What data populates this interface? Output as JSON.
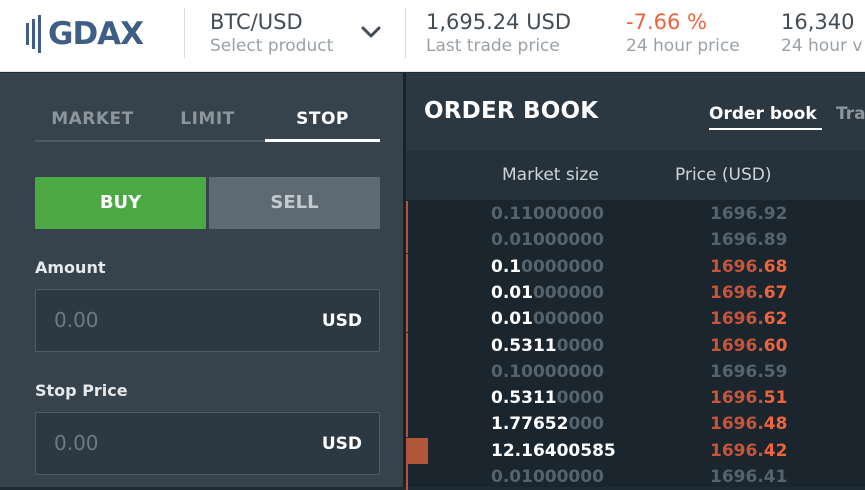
{
  "header": {
    "logo": "GDAX",
    "product": "BTC/USD",
    "product_sub": "Select product",
    "last_price": "1,695.24 USD",
    "last_price_sub": "Last trade price",
    "change": "-7.66 %",
    "change_sub": "24 hour price",
    "volume": "16,340",
    "volume_sub": "24 hour v"
  },
  "order_form": {
    "tabs": [
      "MARKET",
      "LIMIT",
      "STOP"
    ],
    "active_tab": "STOP",
    "buy_label": "BUY",
    "sell_label": "SELL",
    "amount_label": "Amount",
    "amount_value": "0.00",
    "amount_unit": "USD",
    "stop_label": "Stop Price",
    "stop_value": "0.00",
    "stop_unit": "USD"
  },
  "order_book": {
    "title": "ORDER BOOK",
    "tab_orderbook": "Order book",
    "tab_trade": "Tra",
    "col_size": "Market size",
    "col_price": "Price (USD)",
    "rows": [
      {
        "size_bright": "",
        "size_dim": "0.11000000",
        "price_bright": "",
        "price_dim": "1696.92",
        "depth": 0.002
      },
      {
        "size_bright": "",
        "size_dim": "0.01000000",
        "price_bright": "",
        "price_dim": "1696.89",
        "depth": 0.002
      },
      {
        "size_bright": "0.1",
        "size_dim": "0000000",
        "price_bright": "1696.",
        "price_dim": "68",
        "depth": 0.002
      },
      {
        "size_bright": "0.01",
        "size_dim": "000000",
        "price_bright": "1696.",
        "price_dim": "67",
        "depth": 0.002
      },
      {
        "size_bright": "0.01",
        "size_dim": "000000",
        "price_bright": "1696.",
        "price_dim": "62",
        "depth": 0.002
      },
      {
        "size_bright": "0.5311",
        "size_dim": "0000",
        "price_bright": "1696.",
        "price_dim": "60",
        "depth": 0.002
      },
      {
        "size_bright": "",
        "size_dim": "0.10000000",
        "price_bright": "",
        "price_dim": "1696.59",
        "depth": 0.002
      },
      {
        "size_bright": "0.5311",
        "size_dim": "0000",
        "price_bright": "1696.",
        "price_dim": "51",
        "depth": 0.002
      },
      {
        "size_bright": "1.77652",
        "size_dim": "000",
        "price_bright": "1696.",
        "price_dim": "48",
        "depth": 0.004
      },
      {
        "size_bright": "12.16400585",
        "size_dim": "",
        "price_bright": "1696.",
        "price_dim": "42",
        "depth": 0.048
      },
      {
        "size_bright": "",
        "size_dim": "0.01000000",
        "price_bright": "",
        "price_dim": "1696.41",
        "depth": 0.002
      }
    ]
  },
  "colors": {
    "buy": "#4ca842",
    "sell_price": "#f0643c",
    "brand": "#3e5e86"
  }
}
